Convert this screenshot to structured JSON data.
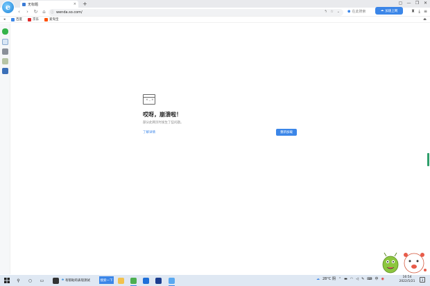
{
  "tab": {
    "title": "无标题",
    "close_glyph": "×"
  },
  "toolbar": {
    "new_tab_glyph": "+",
    "back_glyph": "‹",
    "forward_glyph": "›",
    "reload_glyph": "↻",
    "home_glyph": "⌂"
  },
  "address": {
    "url": "wenda.so.com/",
    "info_glyph": "ⓘ"
  },
  "search": {
    "placeholder": "在此搜索"
  },
  "cloud_button": {
    "label": "加速上网"
  },
  "window_controls": [
    "▢",
    "—",
    "❐",
    "✕"
  ],
  "bookmarks": {
    "items": [
      {
        "label": "百度",
        "color": "#3b86e8"
      },
      {
        "label": "京东",
        "color": "#e02b2b"
      },
      {
        "label": "爱淘宝",
        "color": "#ff5000"
      }
    ]
  },
  "error": {
    "icon_text": "×_×",
    "title": "哎呀，崩溃啦！",
    "subtitle": "部分此网页时发生了些问题。",
    "link": "了解详情",
    "reload_button": "重新加载"
  },
  "taskbar": {
    "task_label": "有帮助的表现测试",
    "search_label": "搜索一下",
    "weather": "28°C 阴",
    "time": "16:54",
    "date": "2022/5/21",
    "notification_glyph": "3"
  },
  "colors": {
    "accent": "#3b86e8",
    "taskbar": "#dfe8f3"
  }
}
